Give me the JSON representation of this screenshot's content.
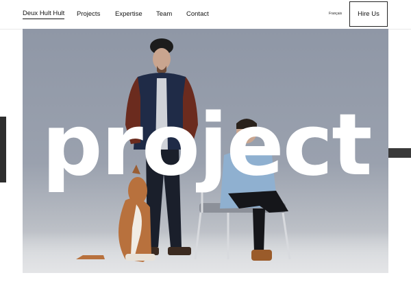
{
  "header": {
    "logo": "Deux Hult Hult",
    "nav": [
      "Projects",
      "Expertise",
      "Team",
      "Contact"
    ],
    "language": "Français",
    "cta": "Hire Us"
  },
  "hero": {
    "word": "project"
  },
  "colors": {
    "accent_dark": "#2e2e2e",
    "hero_bg": "#9aa1ae"
  }
}
